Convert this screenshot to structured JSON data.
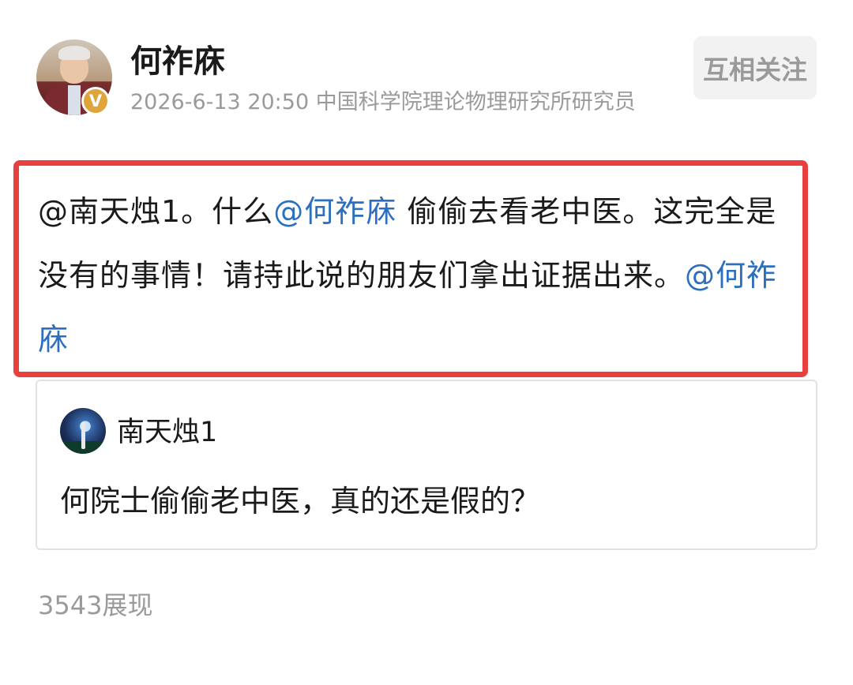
{
  "post": {
    "author": {
      "name": "何祚庥",
      "verified_badge": "V",
      "avatar": "author-avatar-photo"
    },
    "meta": {
      "time": "2026-6-13 20:50",
      "bio": "中国科学院理论物理研究所研究员"
    },
    "follow_button": "互相关注",
    "content": {
      "segments": [
        {
          "text": "@南天烛1。什么",
          "mention": false
        },
        {
          "text": "@何祚庥",
          "mention": true
        },
        {
          "text": " 偷偷去看老中医。这完全是没有的事情！请持此说的朋友们拿出证据出来。",
          "mention": false
        },
        {
          "text": "@何祚庥",
          "mention": true
        }
      ]
    },
    "quoted": {
      "author": "南天烛1",
      "avatar": "quoted-avatar-photo",
      "text": "何院士偷偷老中医，真的还是假的？"
    },
    "views": "3543展现"
  },
  "colors": {
    "highlight_border": "#e8403f",
    "mention": "#2c6fbf",
    "verified_badge": "#e0a43a",
    "muted_text": "#9a9a9a"
  }
}
